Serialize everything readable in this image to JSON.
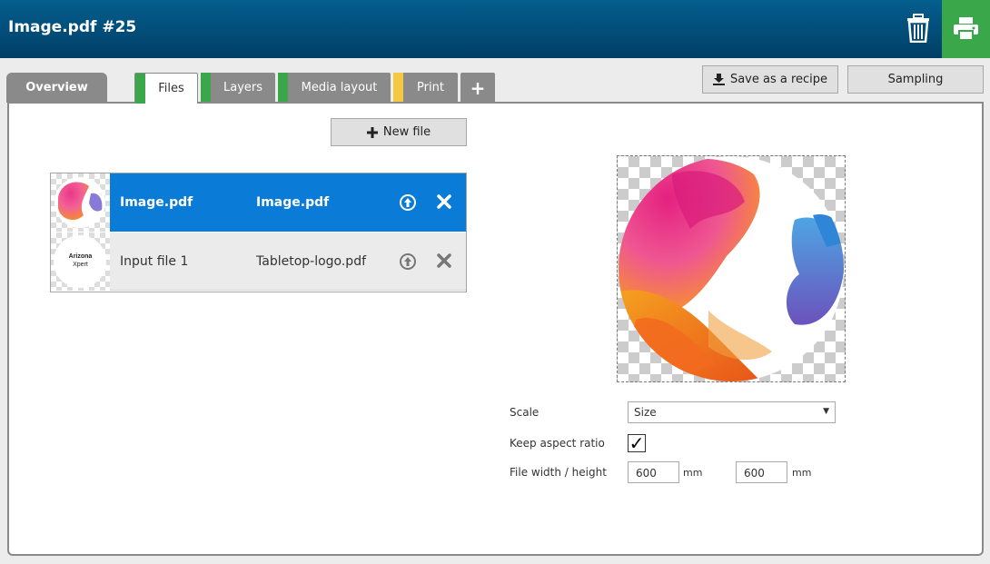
{
  "header": {
    "title": "Image.pdf #25"
  },
  "tabs": {
    "overview": "Overview",
    "files": "Files",
    "layers": "Layers",
    "media": "Media layout",
    "print": "Print",
    "add": "+"
  },
  "colors": {
    "tab_ok": "#3aa84a",
    "tab_warn": "#f5c842",
    "selected": "#0a7cd8"
  },
  "toolbar": {
    "save_recipe": "Save as a recipe",
    "sampling": "Sampling",
    "new_file": "New file"
  },
  "files": [
    {
      "name": "Image.pdf",
      "file": "Image.pdf",
      "selected": true
    },
    {
      "name": "Input file 1",
      "file": "Tabletop-logo.pdf",
      "selected": false
    }
  ],
  "logo_thumb": {
    "line1": "Arizona",
    "line2": "Xpert"
  },
  "settings": {
    "scale_label": "Scale",
    "scale_value": "Size",
    "aspect_label": "Keep aspect ratio",
    "aspect_checked": "✓",
    "size_label": "File width / height",
    "width": "600",
    "height": "600",
    "unit": "mm"
  }
}
